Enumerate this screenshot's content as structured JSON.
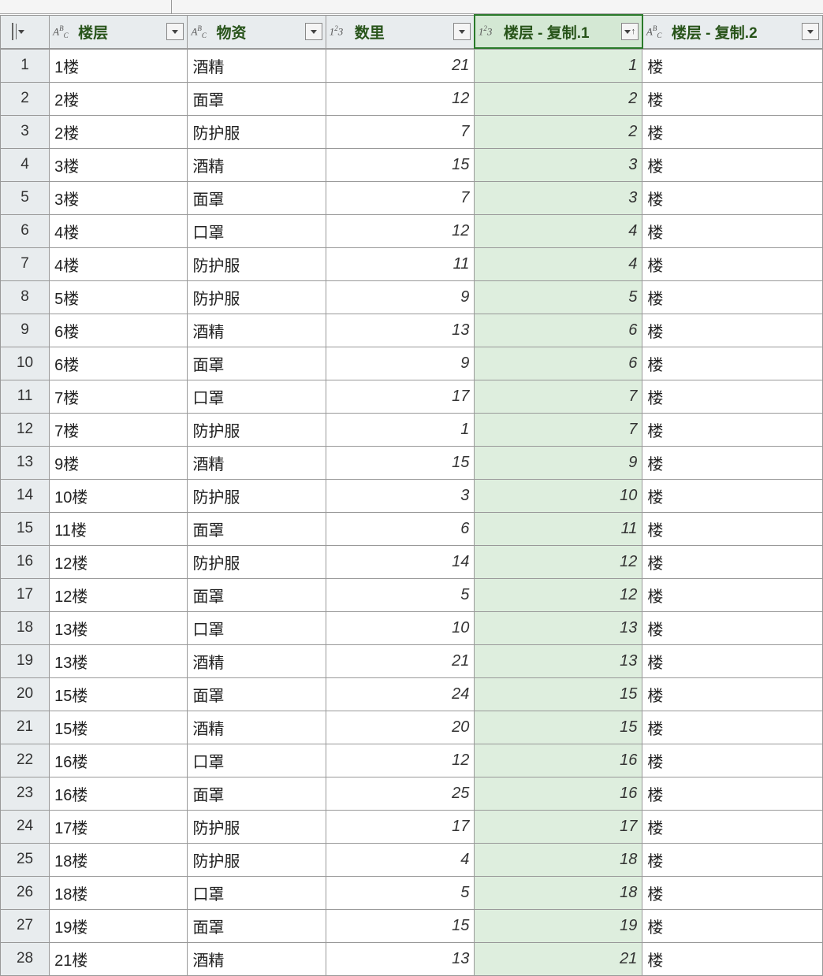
{
  "columns": [
    {
      "name": "楼层",
      "type": "text"
    },
    {
      "name": "物资",
      "type": "text"
    },
    {
      "name": "数里",
      "type": "number"
    },
    {
      "name": "楼层 - 复制.1",
      "type": "number",
      "sorted_asc": true,
      "selected": true
    },
    {
      "name": "楼层 - 复制.2",
      "type": "text"
    }
  ],
  "rows": [
    {
      "n": "1",
      "c1": "1楼",
      "c2": "酒精",
      "c3": "21",
      "c4": "1",
      "c5": "楼"
    },
    {
      "n": "2",
      "c1": "2楼",
      "c2": "面罩",
      "c3": "12",
      "c4": "2",
      "c5": "楼"
    },
    {
      "n": "3",
      "c1": "2楼",
      "c2": "防护服",
      "c3": "7",
      "c4": "2",
      "c5": "楼"
    },
    {
      "n": "4",
      "c1": "3楼",
      "c2": "酒精",
      "c3": "15",
      "c4": "3",
      "c5": "楼"
    },
    {
      "n": "5",
      "c1": "3楼",
      "c2": "面罩",
      "c3": "7",
      "c4": "3",
      "c5": "楼"
    },
    {
      "n": "6",
      "c1": "4楼",
      "c2": "口罩",
      "c3": "12",
      "c4": "4",
      "c5": "楼"
    },
    {
      "n": "7",
      "c1": "4楼",
      "c2": "防护服",
      "c3": "11",
      "c4": "4",
      "c5": "楼"
    },
    {
      "n": "8",
      "c1": "5楼",
      "c2": "防护服",
      "c3": "9",
      "c4": "5",
      "c5": "楼"
    },
    {
      "n": "9",
      "c1": "6楼",
      "c2": "酒精",
      "c3": "13",
      "c4": "6",
      "c5": "楼"
    },
    {
      "n": "10",
      "c1": "6楼",
      "c2": "面罩",
      "c3": "9",
      "c4": "6",
      "c5": "楼"
    },
    {
      "n": "11",
      "c1": "7楼",
      "c2": "口罩",
      "c3": "17",
      "c4": "7",
      "c5": "楼"
    },
    {
      "n": "12",
      "c1": "7楼",
      "c2": "防护服",
      "c3": "1",
      "c4": "7",
      "c5": "楼"
    },
    {
      "n": "13",
      "c1": "9楼",
      "c2": "酒精",
      "c3": "15",
      "c4": "9",
      "c5": "楼"
    },
    {
      "n": "14",
      "c1": "10楼",
      "c2": "防护服",
      "c3": "3",
      "c4": "10",
      "c5": "楼"
    },
    {
      "n": "15",
      "c1": "11楼",
      "c2": "面罩",
      "c3": "6",
      "c4": "11",
      "c5": "楼"
    },
    {
      "n": "16",
      "c1": "12楼",
      "c2": "防护服",
      "c3": "14",
      "c4": "12",
      "c5": "楼"
    },
    {
      "n": "17",
      "c1": "12楼",
      "c2": "面罩",
      "c3": "5",
      "c4": "12",
      "c5": "楼"
    },
    {
      "n": "18",
      "c1": "13楼",
      "c2": "口罩",
      "c3": "10",
      "c4": "13",
      "c5": "楼"
    },
    {
      "n": "19",
      "c1": "13楼",
      "c2": "酒精",
      "c3": "21",
      "c4": "13",
      "c5": "楼"
    },
    {
      "n": "20",
      "c1": "15楼",
      "c2": "面罩",
      "c3": "24",
      "c4": "15",
      "c5": "楼"
    },
    {
      "n": "21",
      "c1": "15楼",
      "c2": "酒精",
      "c3": "20",
      "c4": "15",
      "c5": "楼"
    },
    {
      "n": "22",
      "c1": "16楼",
      "c2": "口罩",
      "c3": "12",
      "c4": "16",
      "c5": "楼"
    },
    {
      "n": "23",
      "c1": "16楼",
      "c2": "面罩",
      "c3": "25",
      "c4": "16",
      "c5": "楼"
    },
    {
      "n": "24",
      "c1": "17楼",
      "c2": "防护服",
      "c3": "17",
      "c4": "17",
      "c5": "楼"
    },
    {
      "n": "25",
      "c1": "18楼",
      "c2": "防护服",
      "c3": "4",
      "c4": "18",
      "c5": "楼"
    },
    {
      "n": "26",
      "c1": "18楼",
      "c2": "口罩",
      "c3": "5",
      "c4": "18",
      "c5": "楼"
    },
    {
      "n": "27",
      "c1": "19楼",
      "c2": "面罩",
      "c3": "15",
      "c4": "19",
      "c5": "楼"
    },
    {
      "n": "28",
      "c1": "21楼",
      "c2": "酒精",
      "c3": "13",
      "c4": "21",
      "c5": "楼"
    }
  ]
}
